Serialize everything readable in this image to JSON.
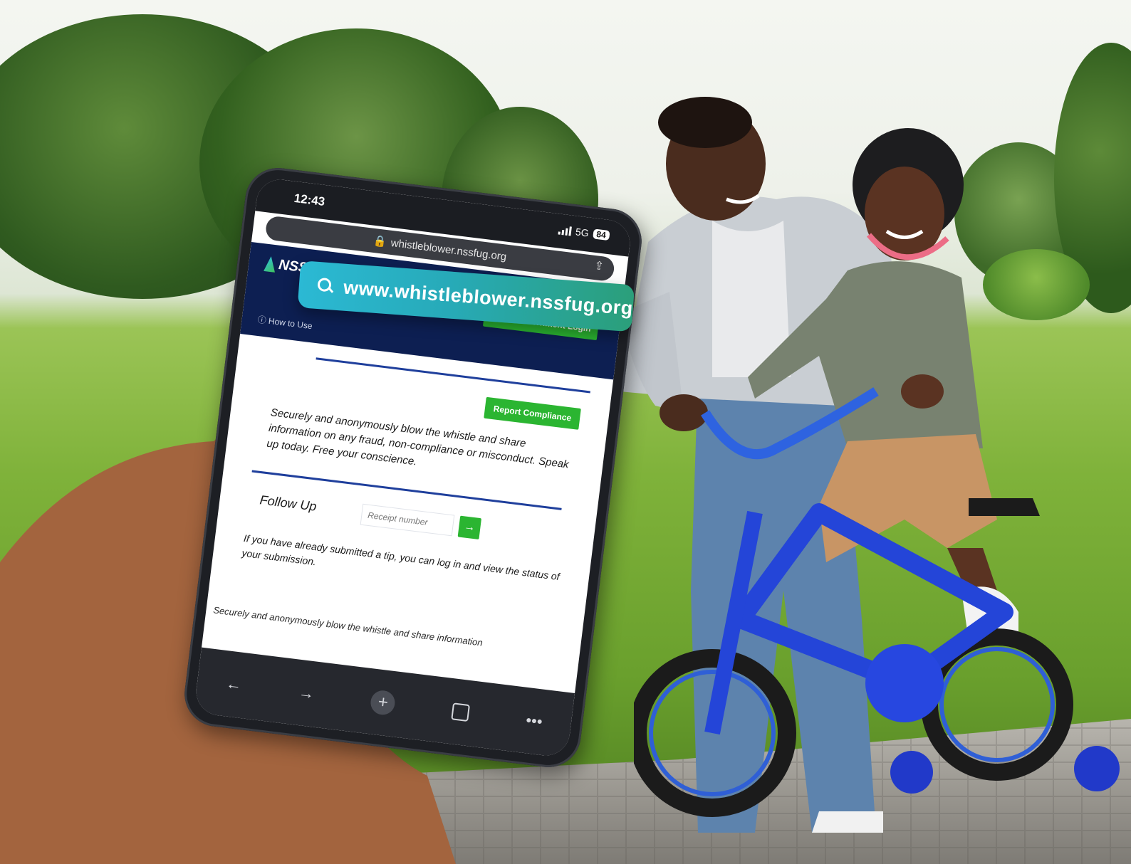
{
  "phone": {
    "time": "12:43",
    "network": "5G",
    "battery": "84",
    "url": "whistleblower.nssfug.org",
    "logo_text": "NSSF",
    "how_to": "How to Use",
    "local_gov_login": "Local Government Login",
    "report_compliance": "Report Compliance",
    "blurb": "Securely and anonymously blow the whistle and share information on any fraud, non-compliance or misconduct. Speak up today. Free your conscience.",
    "follow_up_title": "Follow Up",
    "receipt_placeholder": "Receipt number",
    "go_label": "→",
    "follow_up_text": "If you have already submitted a tip, you can log in and view the status of your submission.",
    "footer_text": "Securely and anonymously blow the whistle and share information"
  },
  "callout": {
    "text": "www.whistleblower.nssfug.org",
    "icon": "search-icon"
  },
  "colors": {
    "header_navy": "#0d1f52",
    "button_green": "#2bb531",
    "pill_start": "#2bb9d4",
    "pill_end": "#2b9f7a"
  }
}
